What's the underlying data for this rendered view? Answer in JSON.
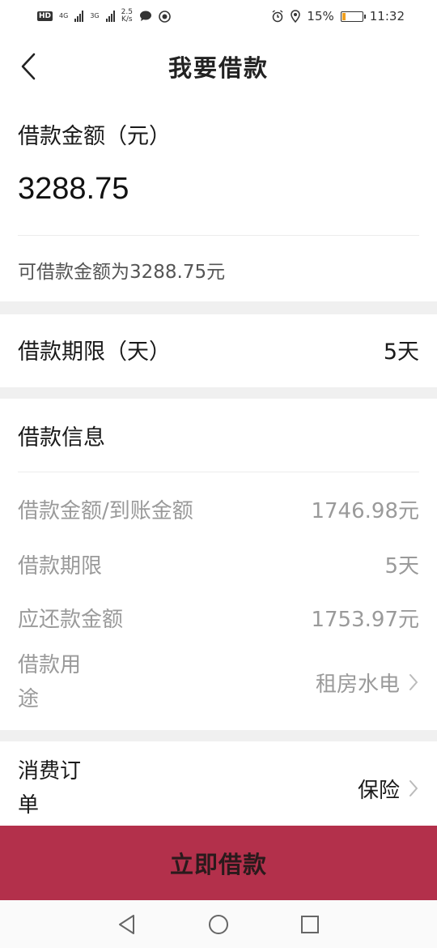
{
  "status_bar": {
    "net1": "4G",
    "net2": "3G",
    "speed_value": "2.5",
    "speed_unit": "K/s",
    "battery": "15%",
    "battery_level": 0.15,
    "time": "11:32"
  },
  "header": {
    "title": "我要借款"
  },
  "amount_section": {
    "label": "借款金额（元）",
    "value": "3288.75",
    "hint": "可借款金额为3288.75元"
  },
  "term_section": {
    "label": "借款期限（天）",
    "value": "5天"
  },
  "info_section": {
    "title": "借款信息",
    "rows": [
      {
        "key": "借款金额/到账金额",
        "value": "1746.98元"
      },
      {
        "key": "借款期限",
        "value": "5天"
      },
      {
        "key": "应还款金额",
        "value": "1753.97元"
      },
      {
        "key": "借款用途",
        "value": "租房水电"
      }
    ]
  },
  "order_section": {
    "key": "消费订单",
    "value": "保险"
  },
  "cta": {
    "label": "立即借款"
  },
  "colors": {
    "accent": "#b3304b",
    "divider_bg": "#f0f0f0"
  }
}
